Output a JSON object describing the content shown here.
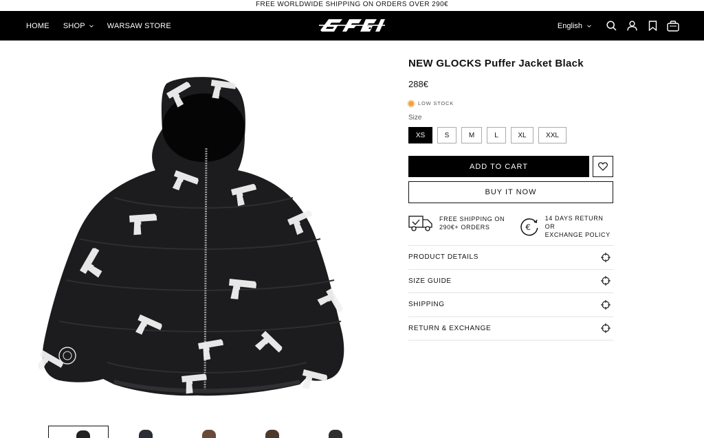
{
  "announcement": "FREE WORLDWIDE SHIPPING ON ORDERS OVER 290€",
  "nav": {
    "links": [
      "HOME",
      "SHOP",
      "WARSAW STORE"
    ],
    "language": "English",
    "icons": [
      "search-icon",
      "account-icon",
      "bookmark-icon",
      "cart-icon"
    ]
  },
  "product": {
    "title": "NEW GLOCKS Puffer Jacket Black",
    "price": "288€",
    "stock_status": "LOW STOCK",
    "size_label": "Size",
    "sizes": [
      "XS",
      "S",
      "M",
      "L",
      "XL",
      "XXL"
    ],
    "selected_size": "XS",
    "add_to_cart": "ADD TO CART",
    "buy_now": "BUY IT NOW"
  },
  "perks": {
    "shipping": [
      "FREE SHIPPING ON",
      "290€+ ORDERS"
    ],
    "returns": [
      "14 DAYS RETURN OR",
      "EXCHANGE POLICY"
    ]
  },
  "accordion": [
    "PRODUCT DETAILS",
    "SIZE GUIDE",
    "SHIPPING",
    "RETURN & EXCHANGE"
  ],
  "colors": {
    "nav_bg": "#000000",
    "stock_dot": "#f5a140",
    "primary_button": "#000000"
  }
}
